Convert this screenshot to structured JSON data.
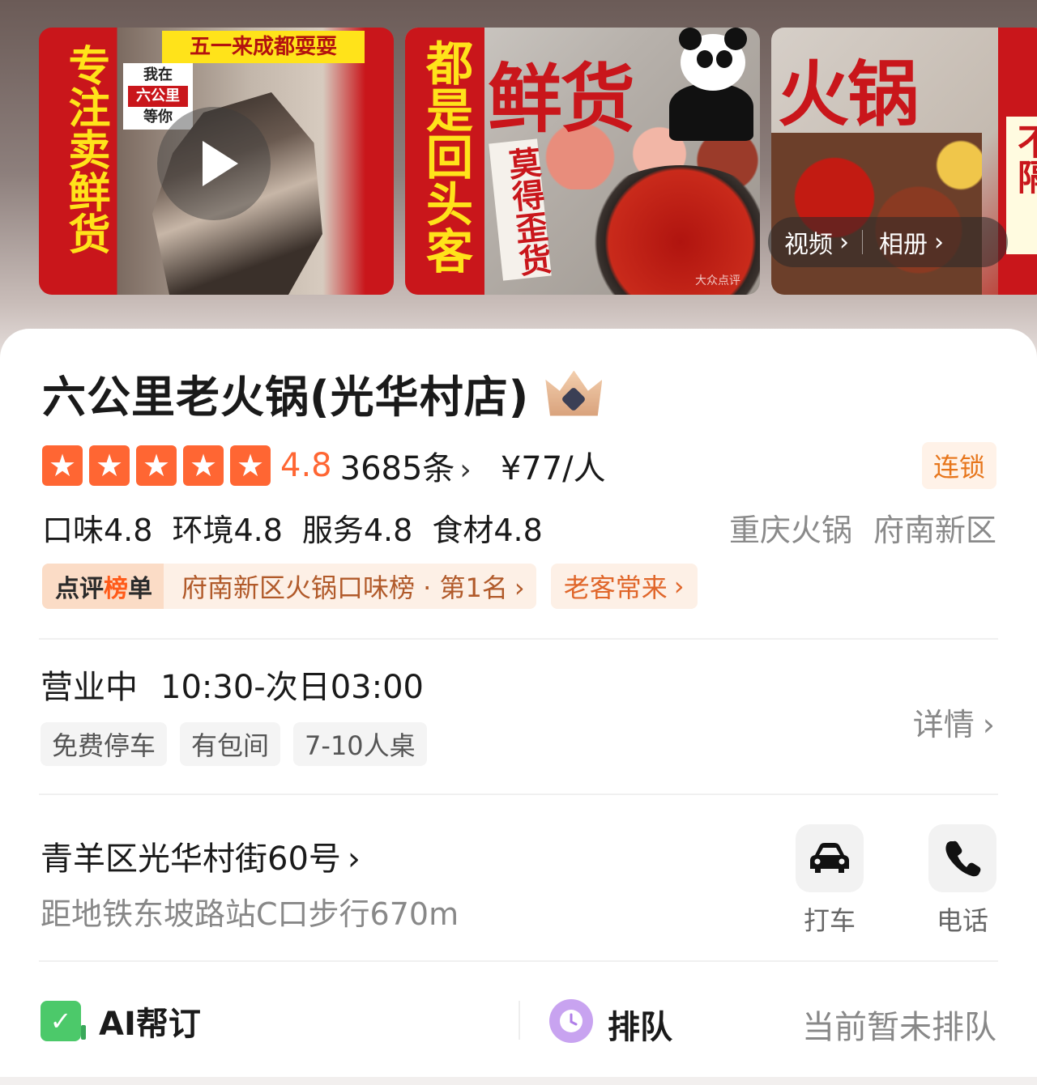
{
  "gallery": {
    "thumb1": {
      "banner": "五一来成都耍耍",
      "vertical_text": "专注卖鲜货",
      "small_sign_line1": "我在",
      "small_sign_line2": "六公里",
      "small_sign_line3": "等你"
    },
    "thumb2": {
      "vertical_text": "都是回头客",
      "big_text": "鲜货",
      "tag_text": "莫得歪货",
      "watermark": "大众点评"
    },
    "thumb3": {
      "big_text": "火锅",
      "right_sign": "不隔"
    },
    "chips": {
      "video_label": "视频",
      "album_label": "相册"
    }
  },
  "shop": {
    "name": "六公里老火锅(光华村店)",
    "rating_stars": 5,
    "score": "4.8",
    "review_count": "3685条",
    "price": "¥77/人",
    "chain_badge": "连锁",
    "subscores": [
      "口味4.8",
      "环境4.8",
      "服务4.8",
      "食材4.8"
    ],
    "categories": [
      "重庆火锅",
      "府南新区"
    ],
    "rank": {
      "logo_part1": "点评",
      "logo_part2": "榜",
      "logo_part3": "单",
      "text": "府南新区火锅口味榜 · 第1名"
    },
    "loyal_tag": "老客常来"
  },
  "hours": {
    "status": "营业中",
    "time": "10:30-次日03:00",
    "tags": [
      "免费停车",
      "有包间",
      "7-10人桌"
    ],
    "detail_label": "详情"
  },
  "location": {
    "address": "青羊区光华村街60号",
    "metro": "距地铁东坡路站C口步行670m",
    "taxi_label": "打车",
    "phone_label": "电话"
  },
  "booking": {
    "ai_label": "AI帮订",
    "queue_label": "排队",
    "queue_status": "当前暂未排队"
  },
  "colors": {
    "accent_orange": "#ff6633",
    "poster_red": "#c9161b",
    "poster_yellow": "#ffe31a"
  }
}
